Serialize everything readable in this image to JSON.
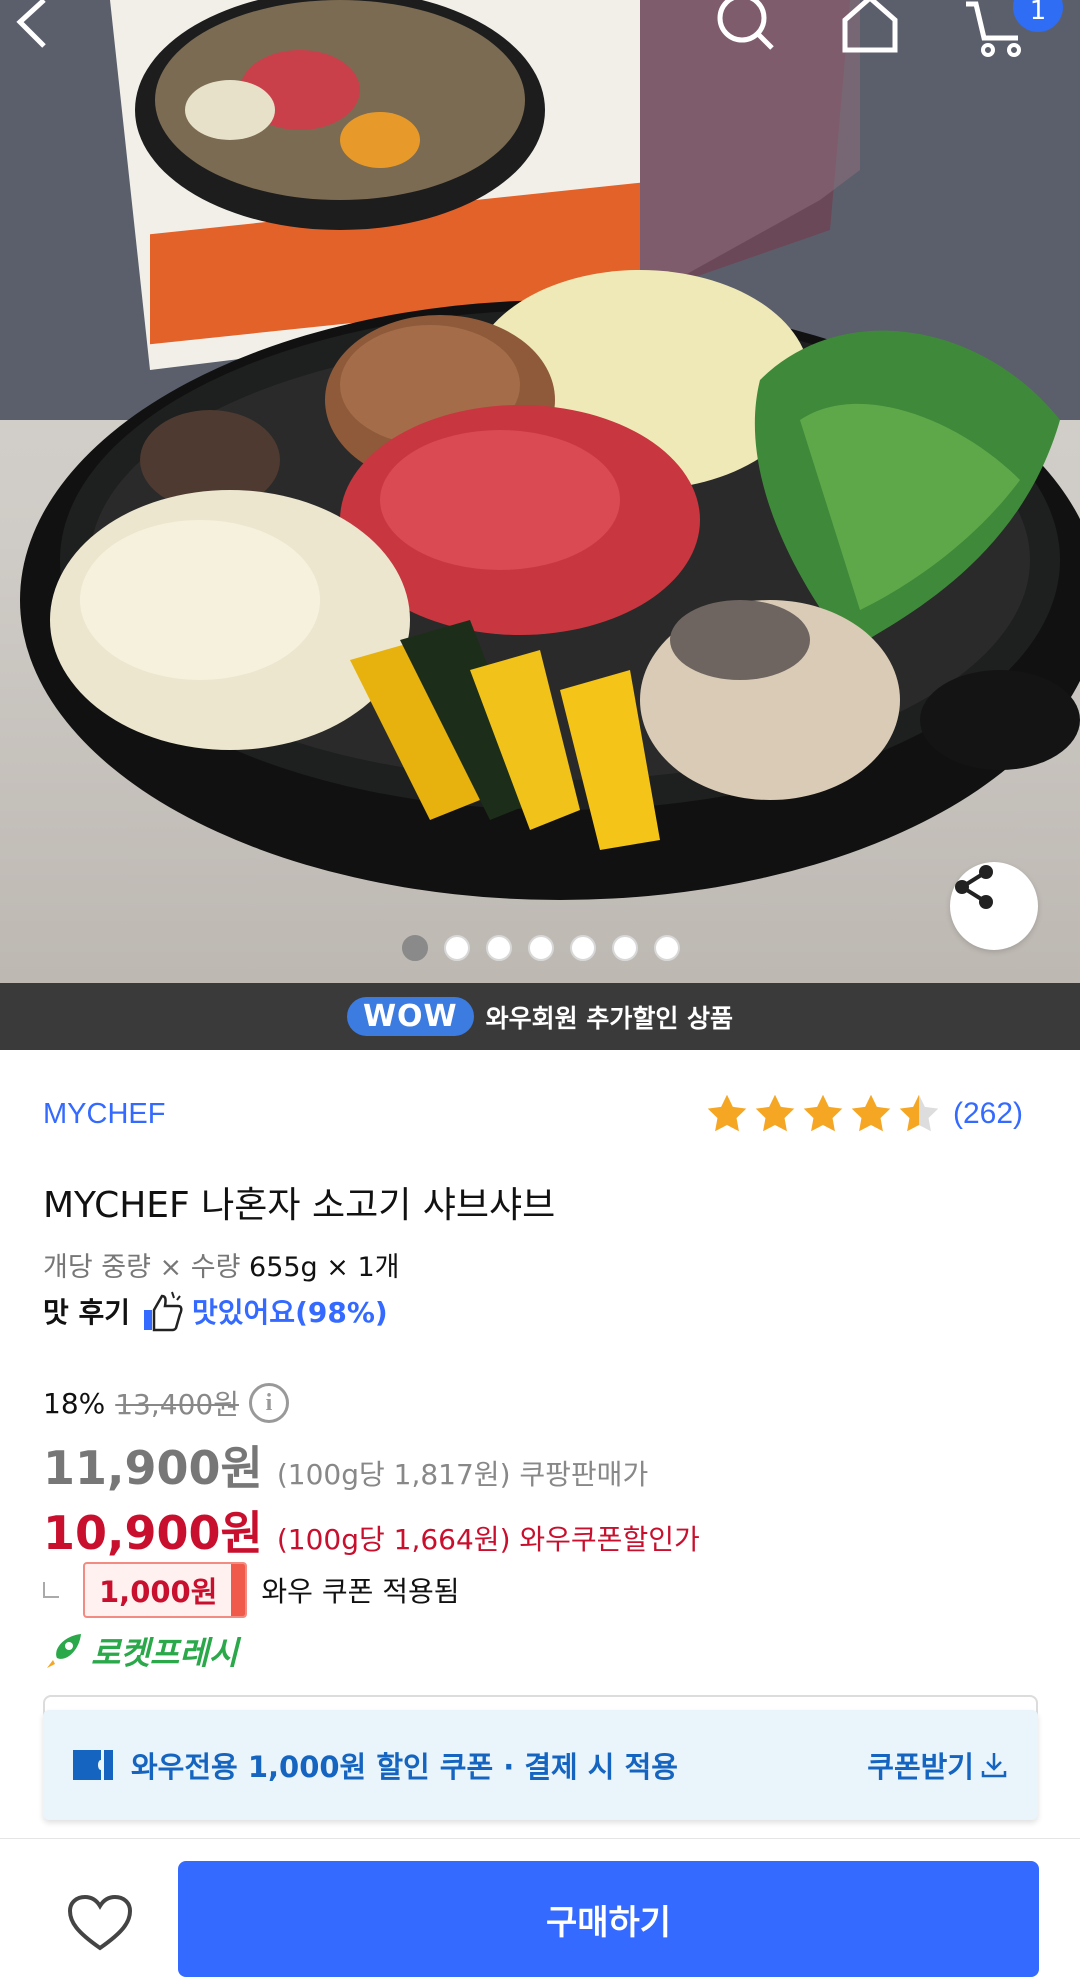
{
  "header": {
    "cart_badge": "1"
  },
  "gallery": {
    "total_images": 7,
    "active_index": 0
  },
  "wow_bar": {
    "badge": "WOW",
    "text": "와우회원 추가할인 상품"
  },
  "product": {
    "brand": "MYCHEF",
    "rating": 4.5,
    "rating_count": "(262)",
    "title": "MYCHEF 나혼자 소고기 샤브샤브",
    "spec_label": "개당 중량 × 수량",
    "spec_value": "655g × 1개",
    "taste_label": "맛 후기",
    "taste_value": "맛있어요(98%)"
  },
  "pricing": {
    "discount_rate": "18%",
    "original_price": "13,400원",
    "price": "11,900원",
    "price_per_unit": "(100g당 1,817원)",
    "price_label": "쿠팡판매가",
    "wow_price": "10,900원",
    "wow_price_per_unit": "(100g당 1,664원)",
    "wow_price_label": "와우쿠폰할인가",
    "coupon_amount": "1,000원",
    "coupon_applied_text": "와우 쿠폰 적용됨",
    "delivery_badge": "로켓프레시"
  },
  "coupon_banner": {
    "message": "와우전용 1,000원 할인 쿠폰 · 결제 시 적용",
    "action": "쿠폰받기"
  },
  "bottom_bar": {
    "buy_label": "구매하기"
  },
  "colors": {
    "accent": "#346aff",
    "sale_red": "#c8102e",
    "rocket_green": "#2aa84a",
    "wow_blue": "#3c7be0"
  }
}
